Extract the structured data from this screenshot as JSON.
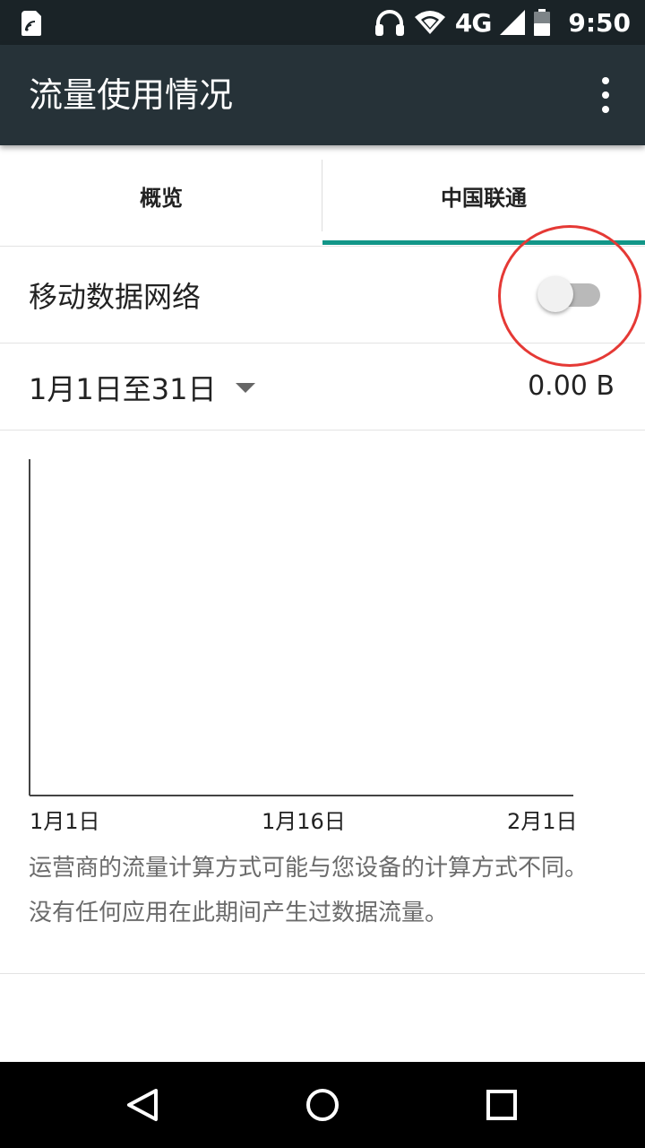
{
  "status_bar": {
    "network_label": "4G",
    "time": "9:50",
    "icons": [
      "sim-card-icon",
      "headphones-icon",
      "wifi-icon",
      "signal-icon",
      "battery-icon"
    ]
  },
  "app_bar": {
    "title": "流量使用情况",
    "overflow_icon": "more-vert-icon"
  },
  "tabs": [
    {
      "label": "概览",
      "selected": false
    },
    {
      "label": "中国联通",
      "selected": true
    }
  ],
  "accent_color": "#129688",
  "mobile_data": {
    "label": "移动数据网络",
    "enabled": false
  },
  "date_range": {
    "label": "1月1日至31日",
    "total": "0.00 B"
  },
  "chart_data": {
    "type": "line",
    "x_ticks": [
      "1月1日",
      "1月16日",
      "2月1日"
    ],
    "series": []
  },
  "notes": {
    "carrier_note": "运营商的流量计算方式可能与您设备的计算方式不同。",
    "no_usage": "没有任何应用在此期间产生过数据流量。"
  },
  "nav_bar": {
    "icons": [
      "back-icon",
      "home-icon",
      "recents-icon"
    ]
  }
}
